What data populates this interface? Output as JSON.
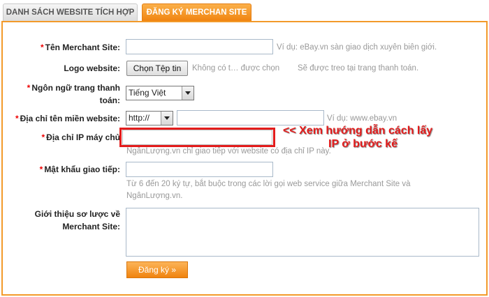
{
  "tabs": [
    {
      "label": "DANH SÁCH WEBSITE TÍCH HỢP"
    },
    {
      "label": "ĐĂNG KÝ MERCHAN SITE"
    }
  ],
  "form": {
    "merchant_site": {
      "label": "Tên Merchant Site:",
      "value": "",
      "hint": "Ví dụ: eBay.vn sàn giao dịch xuyên biên giới."
    },
    "logo": {
      "label": "Logo website:",
      "button": "Chọn Tệp tin",
      "file_status": "Không có t… được chọn",
      "hint": "Sẽ được treo tại trang thanh toán."
    },
    "language": {
      "label_line1": "Ngôn ngữ trang thanh",
      "label_line2": "toán:",
      "value": "Tiếng Việt"
    },
    "domain": {
      "label": "Địa chỉ tên miền website:",
      "protocol": "http://",
      "value": "",
      "hint": "Ví dụ: www.ebay.vn"
    },
    "ip": {
      "label": "Địa chỉ IP máy chủ",
      "value": "",
      "hint": "NgânLượng.vn chỉ giao tiếp với website có địa chỉ IP này."
    },
    "password": {
      "label": "Mật khẩu giao tiếp:",
      "value": "",
      "hint_line1": "Từ 6 đến 20 ký tự, bắt buộc trong các lời gọi web service giữa Merchant Site và",
      "hint_line2": "NgânLượng.vn."
    },
    "intro": {
      "label_line1": "Giới thiệu sơ lược về",
      "label_line2": "Merchant Site:",
      "value": ""
    },
    "submit": "Đăng ký »"
  },
  "required_mark": "*",
  "annotation": {
    "line1": "<< Xem hướng dẫn cách lấy",
    "line2": "IP ở bước kế"
  }
}
